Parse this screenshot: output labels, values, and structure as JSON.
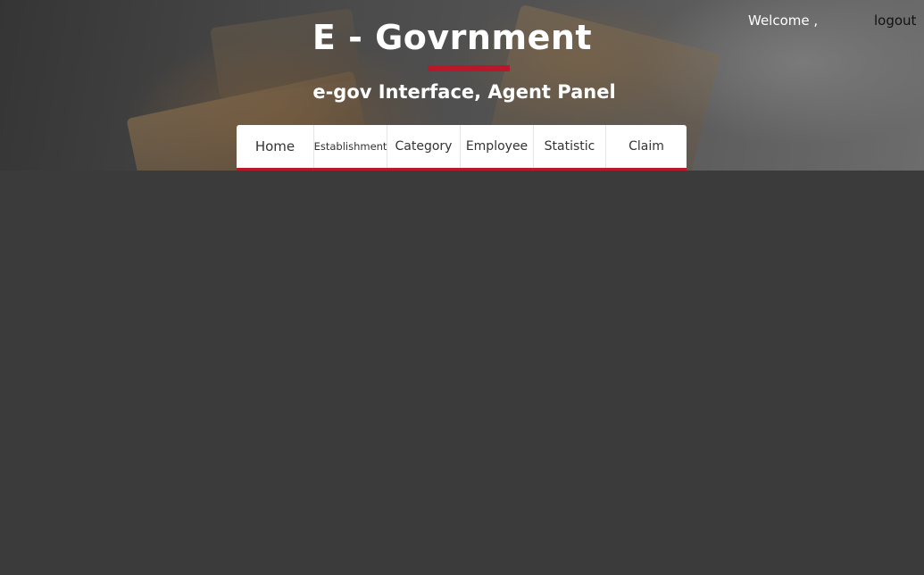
{
  "header": {
    "welcome_text": "Welcome ,",
    "logout_label": "logout",
    "title": "E - Govrnment",
    "subtitle": "e-gov Interface, Agent Panel"
  },
  "nav": {
    "items": [
      {
        "label": "Home"
      },
      {
        "label": "Establishment"
      },
      {
        "label": "Category"
      },
      {
        "label": "Employee"
      },
      {
        "label": "Statistic"
      },
      {
        "label": "Claim"
      }
    ]
  },
  "colors": {
    "accent": "#b8182a",
    "page_background": "#3b3b3b",
    "nav_background": "#ffffff"
  }
}
